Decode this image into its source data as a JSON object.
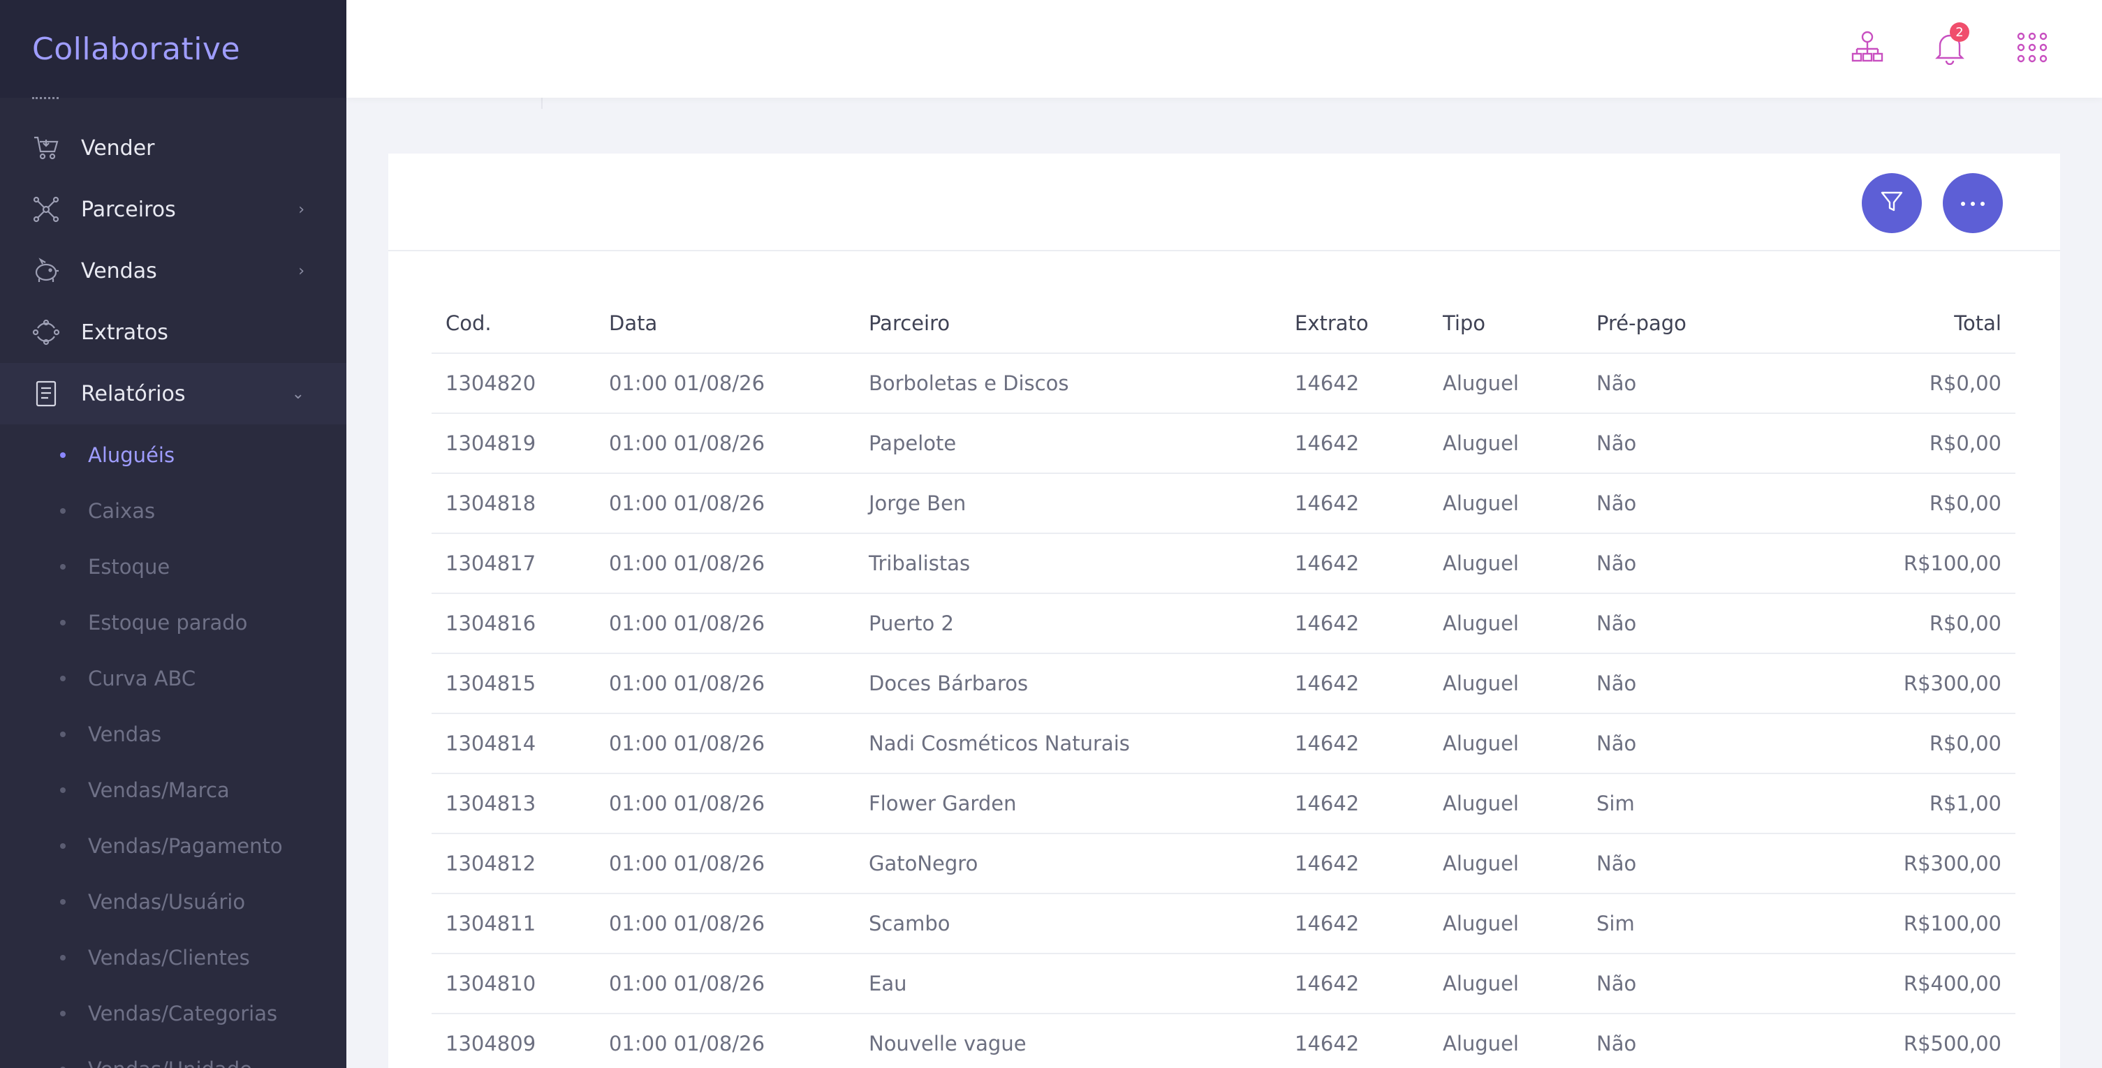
{
  "app": {
    "brand": "Collaborative"
  },
  "sidebar": {
    "items": [
      {
        "label": "Vender",
        "icon": "cart-icon",
        "has_chevron": false
      },
      {
        "label": "Parceiros",
        "icon": "network-icon",
        "has_chevron": true,
        "chevron": "›"
      },
      {
        "label": "Vendas",
        "icon": "piggy-bank-icon",
        "has_chevron": true,
        "chevron": "›"
      },
      {
        "label": "Extratos",
        "icon": "cycle-icon",
        "has_chevron": false
      },
      {
        "label": "Relatórios",
        "icon": "report-icon",
        "has_chevron": true,
        "chevron": "⌄"
      }
    ],
    "submenu": [
      {
        "label": "Aluguéis",
        "active": true
      },
      {
        "label": "Caixas"
      },
      {
        "label": "Estoque"
      },
      {
        "label": "Estoque parado"
      },
      {
        "label": "Curva ABC"
      },
      {
        "label": "Vendas"
      },
      {
        "label": "Vendas/Marca"
      },
      {
        "label": "Vendas/Pagamento"
      },
      {
        "label": "Vendas/Usuário"
      },
      {
        "label": "Vendas/Clientes"
      },
      {
        "label": "Vendas/Categorias"
      },
      {
        "label": "Vendas/Unidade"
      }
    ]
  },
  "topbar": {
    "notification_count": "2",
    "icons": [
      "org-chart-icon",
      "bell-icon",
      "apps-grid-icon"
    ]
  },
  "breadcrumb": {
    "title_fragment": "g"
  },
  "card": {
    "filter_icon": "filter-icon",
    "more_label": "···"
  },
  "table": {
    "headers": [
      "Cod.",
      "Data",
      "Parceiro",
      "Extrato",
      "Tipo",
      "Pré-pago",
      "Total"
    ],
    "rows": [
      [
        "1304820",
        "01:00 01/08/26",
        "Borboletas e Discos",
        "14642",
        "Aluguel",
        "Não",
        "R$0,00"
      ],
      [
        "1304819",
        "01:00 01/08/26",
        "Papelote",
        "14642",
        "Aluguel",
        "Não",
        "R$0,00"
      ],
      [
        "1304818",
        "01:00 01/08/26",
        "Jorge Ben",
        "14642",
        "Aluguel",
        "Não",
        "R$0,00"
      ],
      [
        "1304817",
        "01:00 01/08/26",
        "Tribalistas",
        "14642",
        "Aluguel",
        "Não",
        "R$100,00"
      ],
      [
        "1304816",
        "01:00 01/08/26",
        "Puerto 2",
        "14642",
        "Aluguel",
        "Não",
        "R$0,00"
      ],
      [
        "1304815",
        "01:00 01/08/26",
        "Doces Bárbaros",
        "14642",
        "Aluguel",
        "Não",
        "R$300,00"
      ],
      [
        "1304814",
        "01:00 01/08/26",
        "Nadi Cosméticos Naturais",
        "14642",
        "Aluguel",
        "Não",
        "R$0,00"
      ],
      [
        "1304813",
        "01:00 01/08/26",
        "Flower Garden",
        "14642",
        "Aluguel",
        "Sim",
        "R$1,00"
      ],
      [
        "1304812",
        "01:00 01/08/26",
        "GatoNegro",
        "14642",
        "Aluguel",
        "Não",
        "R$300,00"
      ],
      [
        "1304811",
        "01:00 01/08/26",
        "Scambo",
        "14642",
        "Aluguel",
        "Sim",
        "R$100,00"
      ],
      [
        "1304810",
        "01:00 01/08/26",
        "Eau",
        "14642",
        "Aluguel",
        "Não",
        "R$400,00"
      ],
      [
        "1304809",
        "01:00 01/08/26",
        "Nouvelle vague",
        "14642",
        "Aluguel",
        "Não",
        "R$500,00"
      ]
    ]
  },
  "colors": {
    "brand": "#9f9dff",
    "sidebar_bg": "#2a2b3e",
    "accent_button": "#5d5fd6",
    "topbar_icon": "#c84fc0",
    "badge": "#f04e6c"
  }
}
